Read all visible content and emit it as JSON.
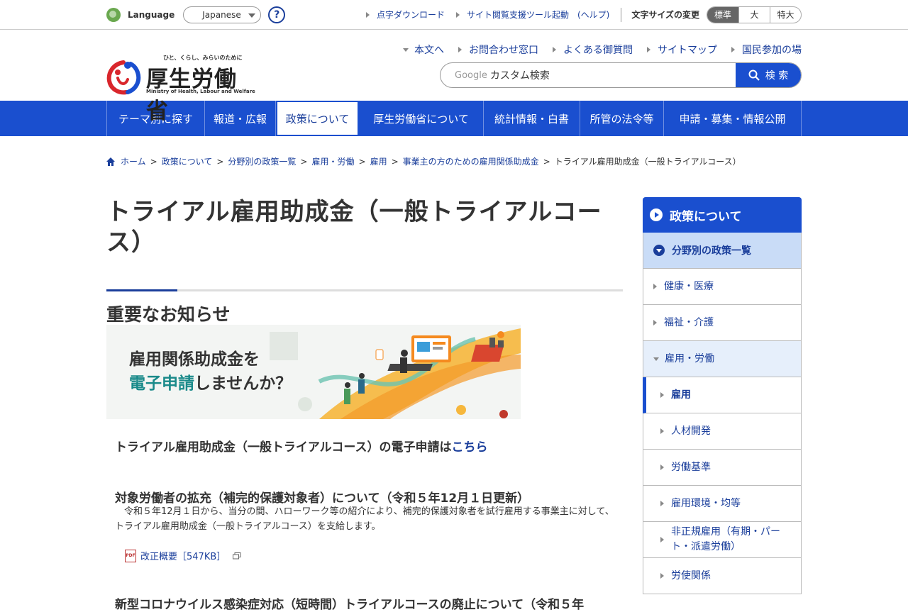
{
  "topbar": {
    "language_label": "Language",
    "language_selected": "Japanese",
    "help_label": "?",
    "links": [
      "点字ダウンロード",
      "サイト閲覧支援ツール起動　(ヘルプ)"
    ],
    "font_size_label": "文字サイズの変更",
    "font_sizes": [
      "標準",
      "大",
      "特大"
    ]
  },
  "header": {
    "logo_tagline": "ひと、くらし、みらいのために",
    "logo_title": "厚生労働省",
    "logo_subtitle": "Ministry of Health, Labour and Welfare",
    "links": [
      "本文へ",
      "お問合わせ窓口",
      "よくある御質問",
      "サイトマップ",
      "国民参加の場"
    ],
    "search_google": "Google",
    "search_placeholder": "カスタム検索",
    "search_button": "検 索"
  },
  "nav": {
    "items": [
      "テーマ別に探す",
      "報道・広報",
      "政策について",
      "厚生労働省について",
      "統計情報・白書",
      "所管の法令等",
      "申請・募集・情報公開"
    ],
    "active_index": 2
  },
  "breadcrumb": [
    "ホーム",
    "政策について",
    "分野別の政策一覧",
    "雇用・労働",
    "雇用",
    "事業主の方のための雇用関係助成金",
    "トライアル雇用助成金（一般トライアルコース）"
  ],
  "main": {
    "title": "トライアル雇用助成金（一般トライアルコース）",
    "section_heading": "重要なお知らせ",
    "banner_line1": "雇用関係助成金を",
    "banner_line2_highlight": "電子申請",
    "banner_line2_rest": "しませんか？",
    "apply_text": "トライアル雇用助成金（一般トライアルコース）の電子申請は",
    "apply_link": "こちら",
    "news1_title": "対象労働者の拡充（補完的保護対象者）について（令和５年12月１日更新）",
    "news1_body": "令和５年12月１日から、当分の間、ハローワーク等の紹介により、補完的保護対象者を試行雇用する事業主に対して、トライアル雇用助成金（一般トライアルコース）を支給します。",
    "pdf_icon_text": "PDF",
    "pdf_link": "改正概要［547KB］",
    "news2_title": "新型コロナウイルス感染症対応（短時間）トライアルコースの廃止について（令和５年"
  },
  "sidebar": {
    "header": "政策について",
    "sub_header": "分野別の政策一覧",
    "items": [
      {
        "label": "健康・医療"
      },
      {
        "label": "福祉・介護"
      },
      {
        "label": "雇用・労働"
      },
      {
        "label": "雇用"
      },
      {
        "label": "人材開発"
      },
      {
        "label": "労働基準"
      },
      {
        "label": "雇用環境・均等"
      },
      {
        "label": "非正規雇用（有期・パート・派遣労働）"
      },
      {
        "label": "労使関係"
      }
    ]
  },
  "colors": {
    "brand_blue": "#1a4fcf",
    "link_blue": "#1a3e9b",
    "logo_red": "#d9262c"
  }
}
